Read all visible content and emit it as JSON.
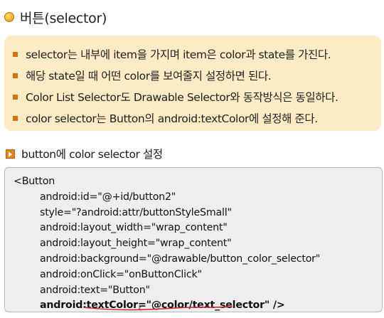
{
  "title": "버튼(selector)",
  "info_items": [
    "selector는 내부에 item을 가지며 item은 color과 state를 가진다.",
    "해당 state일 때 어떤 color를 보여줄지 설정하면 된다.",
    "Color List Selector도 Drawable Selector와 동작방식은 동일하다.",
    "color selector는 Button의 android:textColor에 설정해 준다."
  ],
  "subheading": "button에 color selector 설정",
  "code": {
    "open_tag": "<Button",
    "lines": [
      "android:id=\"@+id/button2\"",
      "style=\"?android:attr/buttonStyleSmall\"",
      "android:layout_width=\"wrap_content\"",
      "android:layout_height=\"wrap_content\"",
      "android:background=\"@drawable/button_color_selector\"",
      "android:onClick=\"onButtonClick\"",
      "android:text=\"Button\""
    ],
    "highlight_line": "android:textColor=\"@color/text_selector\" />"
  },
  "colors": {
    "info_background": "#fcebc4",
    "bullet_square": "#d4720b",
    "code_background": "#eeeeee",
    "pen_annotation": "#d0202a"
  },
  "icons": [
    "title-bullet-icon",
    "subheading-icon"
  ]
}
